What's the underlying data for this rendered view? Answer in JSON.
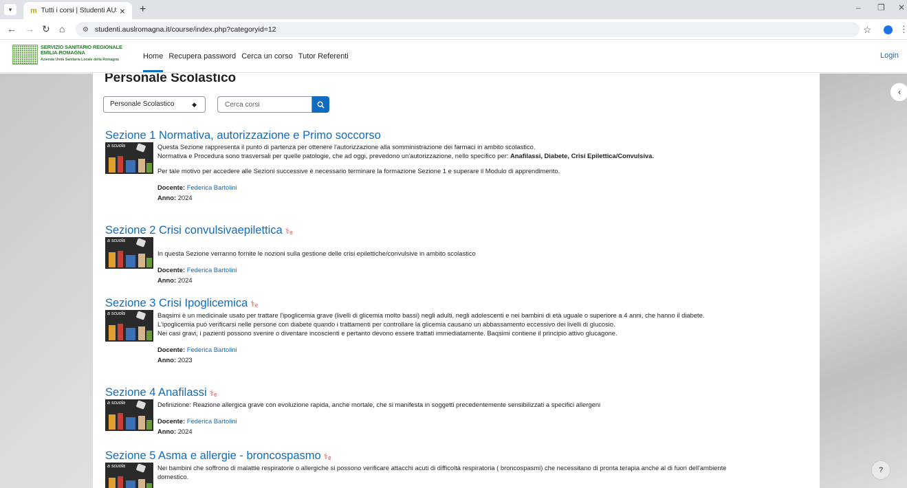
{
  "browser": {
    "tab_title": "Tutti i corsi | Studenti AUSL",
    "tab_close": "×",
    "new_tab": "+",
    "url": "studenti.auslromagna.it/course/index.php?categoryid=12",
    "win_minimize": "–",
    "win_restore": "❐",
    "win_close": "✕"
  },
  "site": {
    "logo_line1": "SERVIZIO SANITARIO REGIONALE",
    "logo_line2": "EMILIA-ROMAGNA",
    "logo_line3": "Azienda Unità Sanitaria Locale della Romagna",
    "nav": [
      "Home",
      "Recupera password",
      "Cerca un corso",
      "Tutor Referenti"
    ],
    "login": "Login"
  },
  "page": {
    "title": "Personale Scolastico",
    "category_select": "Personale Scolastico",
    "search_placeholder": "Cerca corsi"
  },
  "courses": [
    {
      "title": "Sezione 1 Normativa, autorizzazione e Primo soccorso",
      "thumb_text": "a scuola",
      "desc1": "Questa Sezione rappresenta il punto di partenza per ottenere l'autorizzazione alla  somministrazione dei farmaci in ambito scolastico.",
      "desc2": "Normativa e Procedura sono  trasversali per quelle patologie, che ad oggi, prevedono un'autorizzazione, nello specifico  per: ",
      "desc2_bold": "Anafilassi, Diabete, Crisi Epilettica/Convulsiva.",
      "desc3": "Per tale motivo per accedere alle Sezioni successive è necessario terminare la  formazione Sezione 1 e superare il Modulo di apprendimento.",
      "docente_label": "Docente:",
      "docente": "Federica Bartolini",
      "anno_label": "Anno:",
      "anno": "2024"
    },
    {
      "title": "Sezione 2 Crisi convulsivaepilettica",
      "thumb_text": "a scuola",
      "desc1": "In questa Sezione verranno fornite  le nozioni sulla gestione  delle crisi epilettiche/convulsive in ambito scolastico",
      "docente_label": "Docente:",
      "docente": "Federica Bartolini",
      "anno_label": "Anno:",
      "anno": "2024"
    },
    {
      "title": "Sezione 3 Crisi Ipoglicemica",
      "thumb_text": "a scuola",
      "desc1": "Baqsimi è un medicinale usato per trattare l'ipoglicemia grave (livelli di glicemia molto bassi) negli adulti, negli adolescenti e nei bambini di età uguale o superiore a 4 anni, che hanno il diabete.",
      "desc2": "L'ipoglicemia può verificarsi nelle persone con diabete quando i trattamenti per controllare la glicemia causano un abbassamento eccessivo dei livelli di glucosio.",
      "desc3": "Nei casi gravi, i pazienti possono svenire o diventare incoscienti e pertanto devono essere trattati immediatamente. Baqsimi contiene il principio attivo glucagone.",
      "docente_label": "Docente:",
      "docente": "Federica Bartolini",
      "anno_label": "Anno:",
      "anno": "2023"
    },
    {
      "title": "Sezione 4 Anafilassi",
      "thumb_text": "a scuola",
      "desc1": "Definizione: Reazione allergica grave con evoluzione rapida, anche mortale, che si manifesta in soggetti precedentemente sensibilizzati a specifici allergeni",
      "docente_label": "Docente:",
      "docente": "Federica Bartolini",
      "anno_label": "Anno:",
      "anno": "2024"
    },
    {
      "title": "Sezione 5 Asma e allergie - broncospasmo",
      "thumb_text": "a scuola",
      "desc1": "Nei bambini che soffrono di malattie respiratorie o allergiche si possono verificare attacchi acuti di difficoltà respiratoria ( broncospasmi)  che necessitano di pronta terapia anche al di fuori dell'ambiente",
      "desc2": "domestico."
    }
  ],
  "icons": {
    "self_enrol": "⚕ₑ",
    "drawer_toggle": "‹",
    "help": "?"
  }
}
